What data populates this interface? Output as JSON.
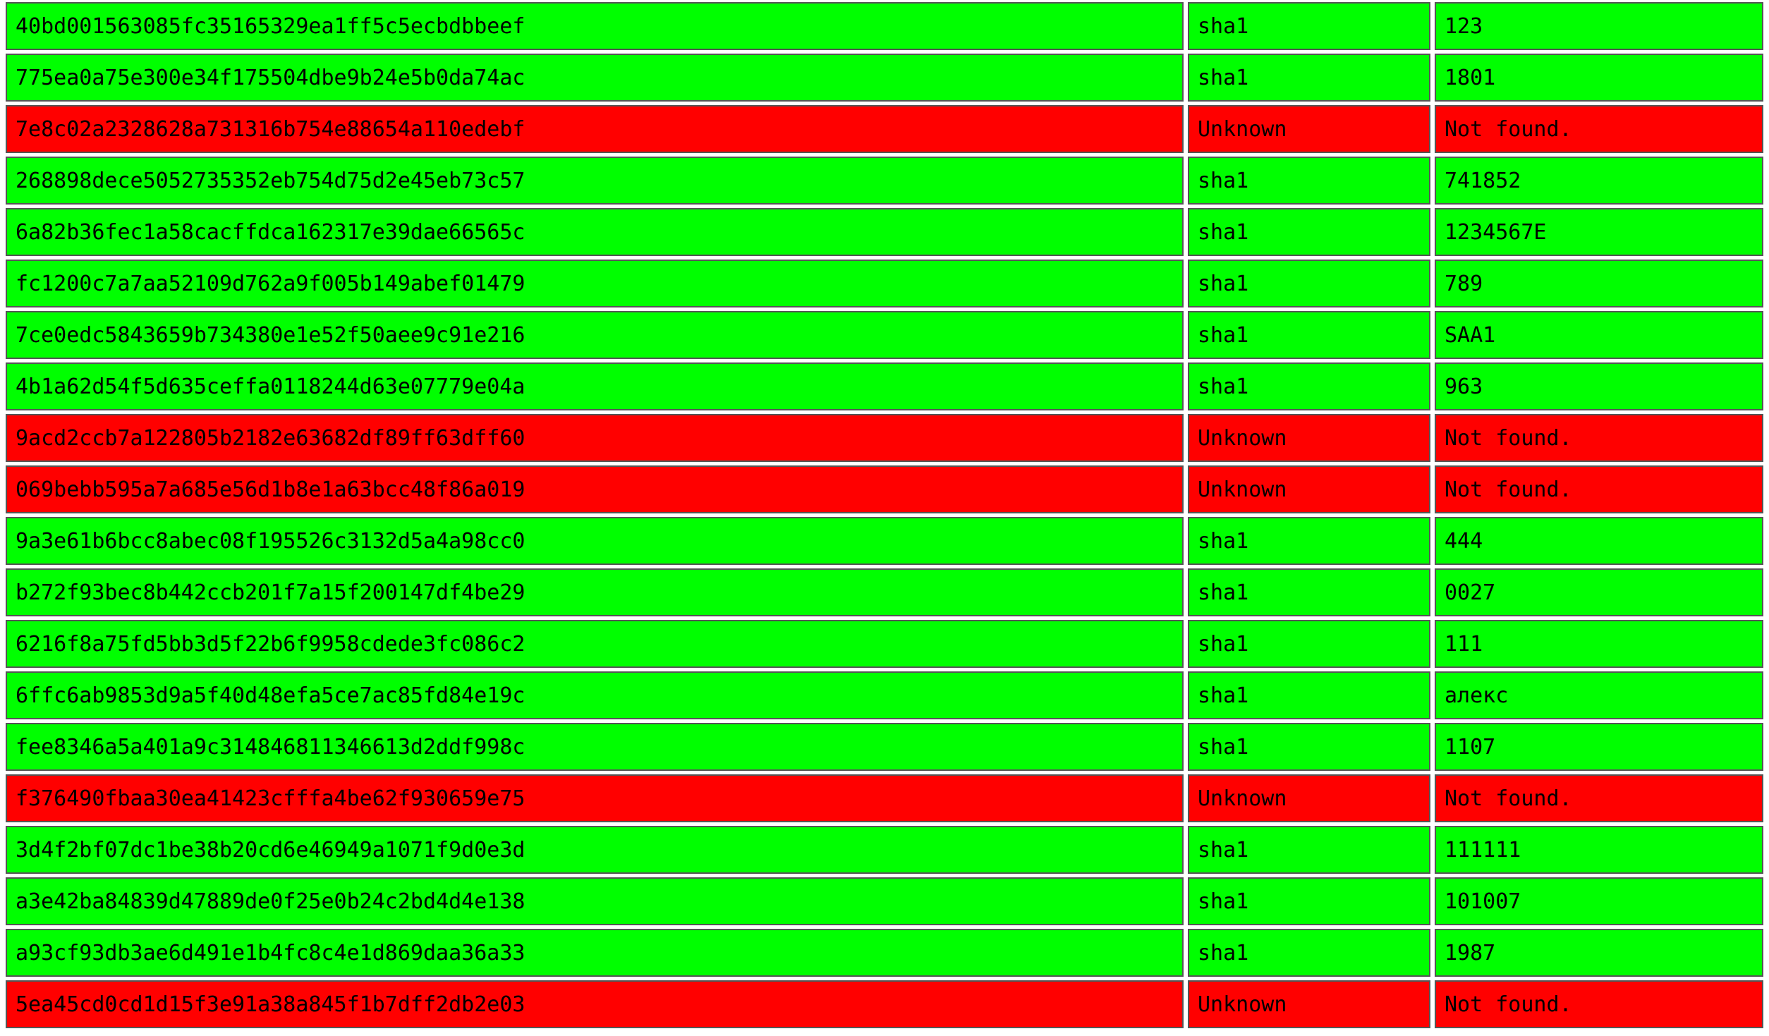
{
  "colors": {
    "found": "#00ff00",
    "not_found": "#ff0000"
  },
  "rows": [
    {
      "hash": "40bd001563085fc35165329ea1ff5c5ecbdbbeef",
      "type": "sha1",
      "result": "123",
      "status": "found"
    },
    {
      "hash": "775ea0a75e300e34f175504dbe9b24e5b0da74ac",
      "type": "sha1",
      "result": "1801",
      "status": "found"
    },
    {
      "hash": "7e8c02a2328628a731316b754e88654a110edebf",
      "type": "Unknown",
      "result": "Not found.",
      "status": "not_found"
    },
    {
      "hash": "268898dece5052735352eb754d75d2e45eb73c57",
      "type": "sha1",
      "result": "741852",
      "status": "found"
    },
    {
      "hash": "6a82b36fec1a58cacffdca162317e39dae66565c",
      "type": "sha1",
      "result": "1234567E",
      "status": "found"
    },
    {
      "hash": "fc1200c7a7aa52109d762a9f005b149abef01479",
      "type": "sha1",
      "result": "789",
      "status": "found"
    },
    {
      "hash": "7ce0edc5843659b734380e1e52f50aee9c91e216",
      "type": "sha1",
      "result": "SAA1",
      "status": "found"
    },
    {
      "hash": "4b1a62d54f5d635ceffa0118244d63e07779e04a",
      "type": "sha1",
      "result": "963",
      "status": "found"
    },
    {
      "hash": "9acd2ccb7a122805b2182e63682df89ff63dff60",
      "type": "Unknown",
      "result": "Not found.",
      "status": "not_found"
    },
    {
      "hash": "069bebb595a7a685e56d1b8e1a63bcc48f86a019",
      "type": "Unknown",
      "result": "Not found.",
      "status": "not_found"
    },
    {
      "hash": "9a3e61b6bcc8abec08f195526c3132d5a4a98cc0",
      "type": "sha1",
      "result": "444",
      "status": "found"
    },
    {
      "hash": "b272f93bec8b442ccb201f7a15f200147df4be29",
      "type": "sha1",
      "result": "0027",
      "status": "found"
    },
    {
      "hash": "6216f8a75fd5bb3d5f22b6f9958cdede3fc086c2",
      "type": "sha1",
      "result": "111",
      "status": "found"
    },
    {
      "hash": "6ffc6ab9853d9a5f40d48efa5ce7ac85fd84e19c",
      "type": "sha1",
      "result": "алекс",
      "status": "found"
    },
    {
      "hash": "fee8346a5a401a9c314846811346613d2ddf998c",
      "type": "sha1",
      "result": "1107",
      "status": "found"
    },
    {
      "hash": "f376490fbaa30ea41423cfffa4be62f930659e75",
      "type": "Unknown",
      "result": "Not found.",
      "status": "not_found"
    },
    {
      "hash": "3d4f2bf07dc1be38b20cd6e46949a1071f9d0e3d",
      "type": "sha1",
      "result": "111111",
      "status": "found"
    },
    {
      "hash": "a3e42ba84839d47889de0f25e0b24c2bd4d4e138",
      "type": "sha1",
      "result": "101007",
      "status": "found"
    },
    {
      "hash": "a93cf93db3ae6d491e1b4fc8c4e1d869daa36a33",
      "type": "sha1",
      "result": "1987",
      "status": "found"
    },
    {
      "hash": "5ea45cd0cd1d15f3e91a38a845f1b7dff2db2e03",
      "type": "Unknown",
      "result": "Not found.",
      "status": "not_found"
    }
  ]
}
